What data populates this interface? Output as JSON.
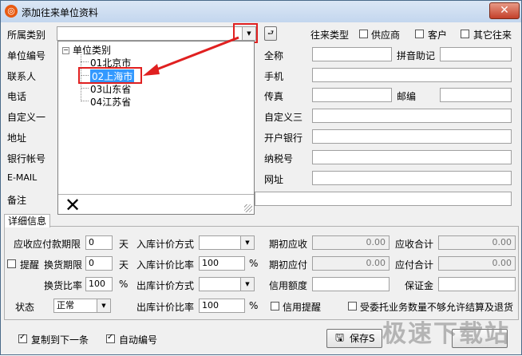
{
  "window": {
    "title": "添加往来单位资料",
    "close": "✕"
  },
  "labels": {
    "category": "所属类别",
    "code": "单位编号",
    "contact": "联系人",
    "phone": "电话",
    "custom1": "自定义一",
    "address": "地址",
    "bank_account": "银行帐号",
    "email": "E-MAIL",
    "remark": "备注",
    "fullname": "全称",
    "pinyin": "拼音助记",
    "mobile": "手机",
    "fax": "传真",
    "zip": "邮编",
    "custom3": "自定义三",
    "bank": "开户银行",
    "tax_no": "纳税号",
    "website": "网址",
    "type": "往来类型",
    "supplier": "供应商",
    "customer": "客户",
    "other": "其它往来"
  },
  "tree": {
    "root": "单位类别",
    "items": [
      "01北京市",
      "02上海市",
      "03山东省",
      "04江苏省"
    ],
    "selected_index": 1
  },
  "tab": {
    "label": "详细信息"
  },
  "detail": {
    "receivable_term": "应收应付款期限",
    "receivable_term_value": "0",
    "days1": "天",
    "in_price_method": "入库计价方式",
    "opening_receivable": "期初应收",
    "opening_receivable_value": "0.00",
    "receivable_total": "应收合计",
    "receivable_total_value": "0.00",
    "remind": "提醒",
    "exchange_term": "换货期限",
    "exchange_term_value": "0",
    "days2": "天",
    "in_price_ratio": "入库计价比率",
    "in_price_ratio_value": "100",
    "pct1": "%",
    "opening_payable": "期初应付",
    "opening_payable_value": "0.00",
    "payable_total": "应付合计",
    "payable_total_value": "0.00",
    "exchange_ratio": "换货比率",
    "exchange_ratio_value": "100",
    "pct2": "%",
    "out_price_method": "出库计价方式",
    "credit_limit": "信用额度",
    "deposit": "保证金",
    "status": "状态",
    "status_value": "正常",
    "out_price_ratio": "出库计价比率",
    "out_price_ratio_value": "100",
    "pct3": "%",
    "credit_remind": "信用提醒",
    "consign_limit": "受委托业务数量不够允许结算及退货"
  },
  "footer": {
    "copy_next": "复制到下一条",
    "auto_number": "自动编号",
    "save": "保存S"
  },
  "watermark": "极速下载站",
  "colors": {
    "accent": "#3399ff",
    "red": "#e02020"
  }
}
